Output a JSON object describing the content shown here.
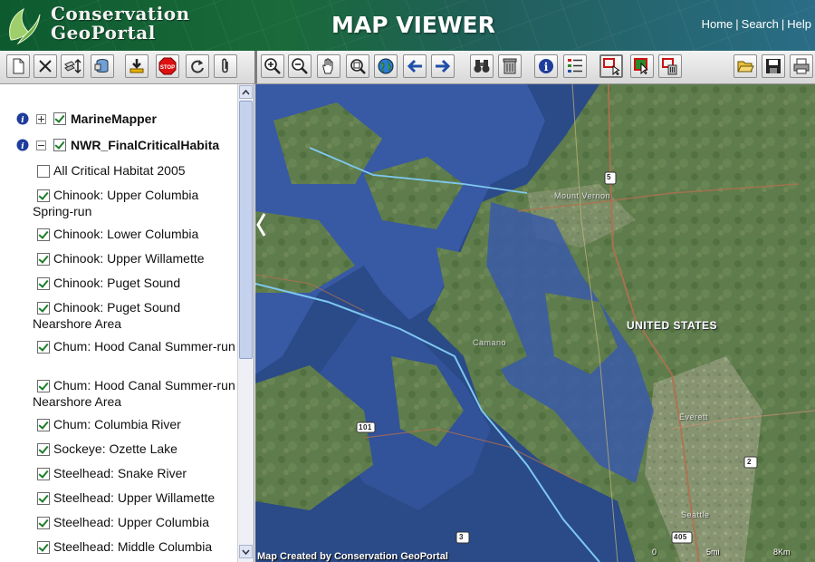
{
  "header": {
    "logo_line1": "Conservation",
    "logo_line2": "GeoPortal",
    "title": "MAP VIEWER",
    "nav": [
      "Home",
      "Search",
      "Help"
    ]
  },
  "toolbar": {
    "left_tools": [
      "new-icon",
      "close-icon",
      "layer-order-icon",
      "database-icon",
      "add-layer-icon",
      "stop-icon",
      "refresh-icon",
      "attach-icon"
    ],
    "map_tools": [
      "zoom-in-icon",
      "zoom-out-icon",
      "pan-hand-icon",
      "zoom-extent-icon",
      "globe-icon",
      "back-arrow-icon",
      "forward-arrow-icon",
      "find-binoculars-icon",
      "clear-icon",
      "identify-info-icon",
      "legend-icon",
      "select-rectangle-icon",
      "select-icon",
      "delete-selection-icon"
    ],
    "right_tools": [
      "open-folder-icon",
      "save-icon",
      "print-icon"
    ]
  },
  "sidebar": {
    "groups": [
      {
        "label": "MarineMapper",
        "expanded": false,
        "checked": true
      },
      {
        "label": "NWR_FinalCriticalHabita",
        "expanded": true,
        "checked": true
      }
    ],
    "layers": [
      {
        "label": "All Critical Habitat 2005",
        "checked": false
      },
      {
        "label": "Chinook: Upper Columbia Spring-run",
        "checked": true
      },
      {
        "label": "Chinook: Lower Columbia",
        "checked": true
      },
      {
        "label": "Chinook: Upper Willamette",
        "checked": true
      },
      {
        "label": "Chinook: Puget Sound",
        "checked": true
      },
      {
        "label": "Chinook: Puget Sound Nearshore Area",
        "checked": true
      },
      {
        "label": "Chum: Hood Canal Summer-run",
        "checked": true
      },
      {
        "label": "Chum: Hood Canal Summer-run Nearshore Area",
        "checked": true
      },
      {
        "label": "Chum: Columbia River",
        "checked": true
      },
      {
        "label": "Sockeye: Ozette Lake",
        "checked": true
      },
      {
        "label": "Steelhead: Snake River",
        "checked": true
      },
      {
        "label": "Steelhead: Upper Willamette",
        "checked": true
      },
      {
        "label": "Steelhead: Upper Columbia",
        "checked": true
      },
      {
        "label": "Steelhead: Middle Columbia",
        "checked": true
      }
    ]
  },
  "map": {
    "labels": [
      "UNITED STATES",
      "Mount Vernon",
      "Camano",
      "Everett",
      "Seattle"
    ],
    "highway_shields": [
      "5",
      "101",
      "2",
      "3",
      "405"
    ],
    "credit": "Map Created by Conservation GeoPortal",
    "scale_labels": [
      "0",
      "5mi",
      "8Km"
    ],
    "colors": {
      "water": "#2b4f8c",
      "habitat": "#3a5aa8",
      "land": "#5d7a4a",
      "route": "#7ec8f0"
    }
  }
}
